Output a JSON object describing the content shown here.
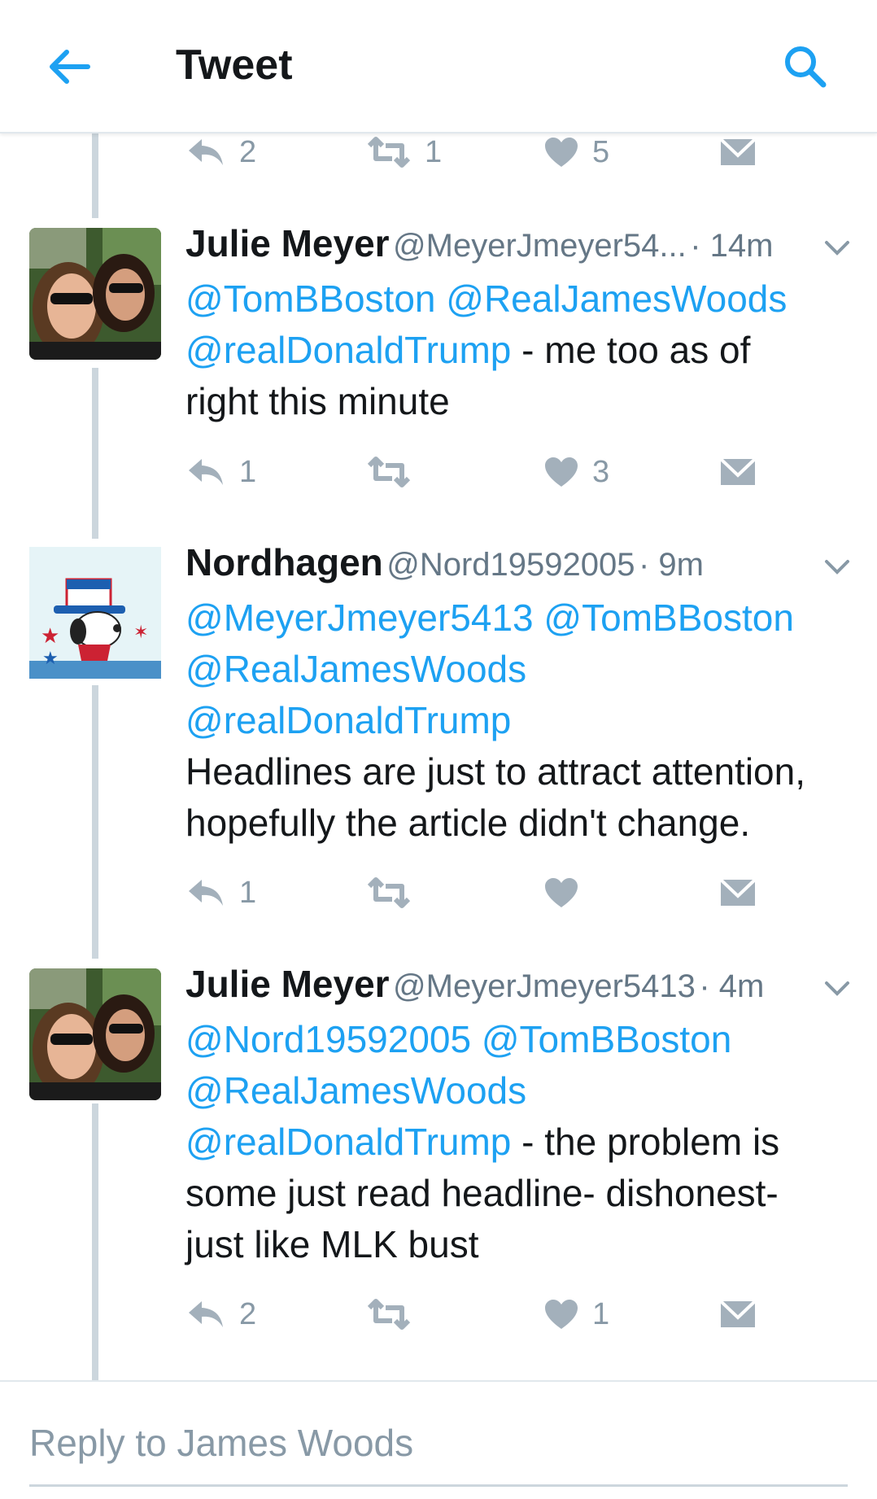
{
  "header": {
    "title": "Tweet",
    "back_icon": "back-arrow-icon",
    "search_icon": "search-icon"
  },
  "colors": {
    "accent": "#1da1f2",
    "text": "#14171a",
    "muted": "#8899a6",
    "thread_line": "#ccd6dd"
  },
  "top_actions": {
    "reply_count": "2",
    "retweet_count": "1",
    "like_count": "5"
  },
  "tweets": [
    {
      "name": "Julie Meyer",
      "handle": "@MeyerJmeyer54...",
      "time": "· 14m",
      "mentions_line1": "@TomBBoston @RealJamesWoods",
      "mention_inline": "@realDonaldTrump",
      "text_inline": " - me too as of",
      "text_rest": "right this minute",
      "reply_count": "1",
      "retweet_count": "",
      "like_count": "3"
    },
    {
      "name": "Nordhagen",
      "handle": "@Nord19592005",
      "time": "· 9m",
      "mentions_line1": "@MeyerJmeyer5413 @TomBBoston",
      "mentions_line2": "@RealJamesWoods",
      "mentions_line3": "@realDonaldTrump",
      "text_line1": "Headlines are just to attract attention,",
      "text_line2": "hopefully the article didn't change.",
      "reply_count": "1",
      "retweet_count": "",
      "like_count": ""
    },
    {
      "name": "Julie Meyer",
      "handle": "@MeyerJmeyer5413",
      "time": "· 4m",
      "mentions_line1": "@Nord19592005 @TomBBoston",
      "mentions_line2": "@RealJamesWoods",
      "mention_inline": "@realDonaldTrump",
      "text_inline": " - the problem is",
      "text_line2": "some just read headline- dishonest-",
      "text_line3": "just like MLK bust",
      "reply_count": "2",
      "retweet_count": "",
      "like_count": "1"
    }
  ],
  "reply_box": {
    "placeholder": "Reply to James Woods"
  }
}
